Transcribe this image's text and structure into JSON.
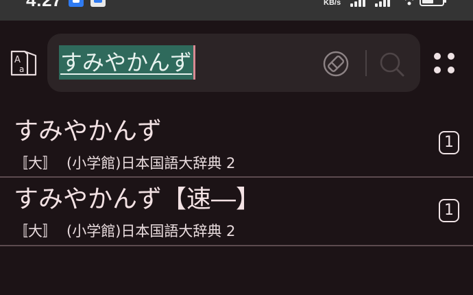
{
  "status_bar": {
    "time": "4:27",
    "net_speed": "KB/s"
  },
  "search": {
    "query": "すみやかんず"
  },
  "results": [
    {
      "word": "すみやかんず",
      "dict_tag": "〚大〛",
      "dict_name": "(小学館)日本国語大辞典 2",
      "count": "1"
    },
    {
      "word": "すみやかんず【速―】",
      "dict_tag": "〚大〛",
      "dict_name": "(小学館)日本国語大辞典 2",
      "count": "1"
    }
  ],
  "icons": {
    "dict_switch": "dictionary-switch-icon",
    "clear": "clear-eraser-icon",
    "search": "search-icon",
    "more": "more-grid-icon"
  },
  "colors": {
    "background": "#1c1316",
    "search_box": "#2c2426",
    "selection": "#2f6a5c",
    "cursor": "#d98a93"
  }
}
